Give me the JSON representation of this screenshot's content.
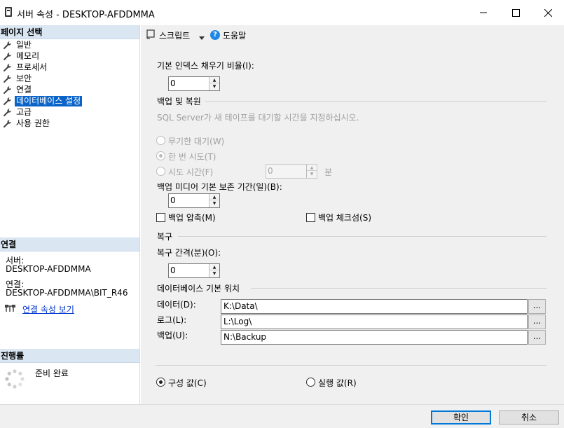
{
  "window": {
    "title": "서버 속성 - DESKTOP-AFDDMMA",
    "minimize": "—",
    "maximize": "☐",
    "close": "✕"
  },
  "left": {
    "pages_header": "페이지 선택",
    "pages": [
      {
        "label": "일반"
      },
      {
        "label": "메모리"
      },
      {
        "label": "프로세서"
      },
      {
        "label": "보안"
      },
      {
        "label": "연결"
      },
      {
        "label": "데이터베이스 설정",
        "selected": true
      },
      {
        "label": "고급"
      },
      {
        "label": "사용 권한"
      }
    ],
    "connection_header": "연결",
    "server_label": "서버:",
    "server_value": "DESKTOP-AFDDMMA",
    "connection_label": "연결:",
    "connection_value": "DESKTOP-AFDDMMA\\BIT_R46",
    "view_connection_link": "연결 속성 보기",
    "progress_header": "진행률",
    "progress_status": "준비 완료"
  },
  "toolbar": {
    "script_label": "스크립트",
    "help_label": "도움말"
  },
  "settings": {
    "fill_factor_label": "기본 인덱스 채우기 비율(I):",
    "fill_factor_value": "0",
    "backup_restore_group": "백업 및 복원",
    "backup_hint": "SQL Server가 새 테이프를 대기할 시간을 지정하십시오.",
    "radio_wait_indefinitely": "무기한 대기(W)",
    "radio_try_once": "한 번 시도(T)",
    "radio_try_for": "시도 시간(F)",
    "try_minutes_value": "0",
    "minutes_unit": "분",
    "retention_label": "백업 미디어 기본 보존 기간(일)(B):",
    "retention_value": "0",
    "compress_backup_label": "백업 압축(M)",
    "backup_checksum_label": "백업 체크섬(S)",
    "recovery_group": "복구",
    "recovery_interval_label": "복구 간격(분)(O):",
    "recovery_interval_value": "0",
    "db_default_locations_group": "데이터베이스 기본 위치",
    "data_label": "데이터(D):",
    "data_value": "K:\\Data\\",
    "log_label": "로그(L):",
    "log_value": "L:\\Log\\",
    "backup_label": "백업(U):",
    "backup_value": "N:\\Backup",
    "browse_label": "...",
    "configured_values_label": "구성 값(C)",
    "running_values_label": "실행 값(R)"
  },
  "buttons": {
    "ok": "확인",
    "cancel": "취소"
  },
  "colors": {
    "selection": "#0a64c8",
    "section_header": "#dae6f2",
    "help_icon": "#1e88e5",
    "link": "#0033cc"
  },
  "icons": [
    "app-icon",
    "wrench-icon",
    "script-icon",
    "dropdown-arrow-icon",
    "help-icon",
    "connection-properties-icon",
    "progress-spinner-icon"
  ]
}
